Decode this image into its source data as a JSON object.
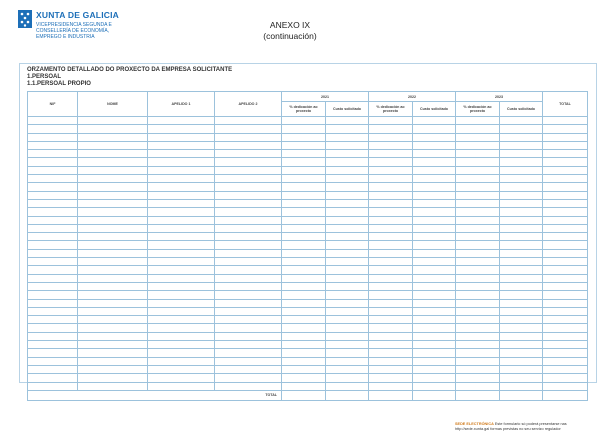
{
  "header": {
    "org_name": "XUNTA DE GALICIA",
    "org_lines": [
      "VICEPRESIDENCIA SEGUNDA E",
      "CONSELLERÍA DE ECONOMÍA,",
      "EMPREGO E INDUSTRIA"
    ],
    "annex_title": "ANEXO IX",
    "annex_subtitle": "(continuación)"
  },
  "section": {
    "title": "ORZAMENTO DETALLADO DO PROXECTO DA EMPRESA SOLICITANTE",
    "sub1": "1.PERSOAL",
    "sub2": "1.1.PERSOAL PROPIO"
  },
  "table": {
    "col_nif": "NIF",
    "col_nome": "NOME",
    "col_apelido1": "APELIDO 1",
    "col_apelido2": "APELIDO 2",
    "years": [
      "2021",
      "2022",
      "2023"
    ],
    "col_total": "TOTAL",
    "sub_dedicacion": "% dedicación ao proxecto",
    "sub_custo": "Custo solicitado",
    "total_label": "TOTAL"
  },
  "footer": {
    "sede": "SEDE ELECTRÓNICA",
    "line1": "Este formulario só poderá presentarse nas",
    "line2": "http://sede.xunta.gal  formas previstas no seu servizo regulador"
  }
}
